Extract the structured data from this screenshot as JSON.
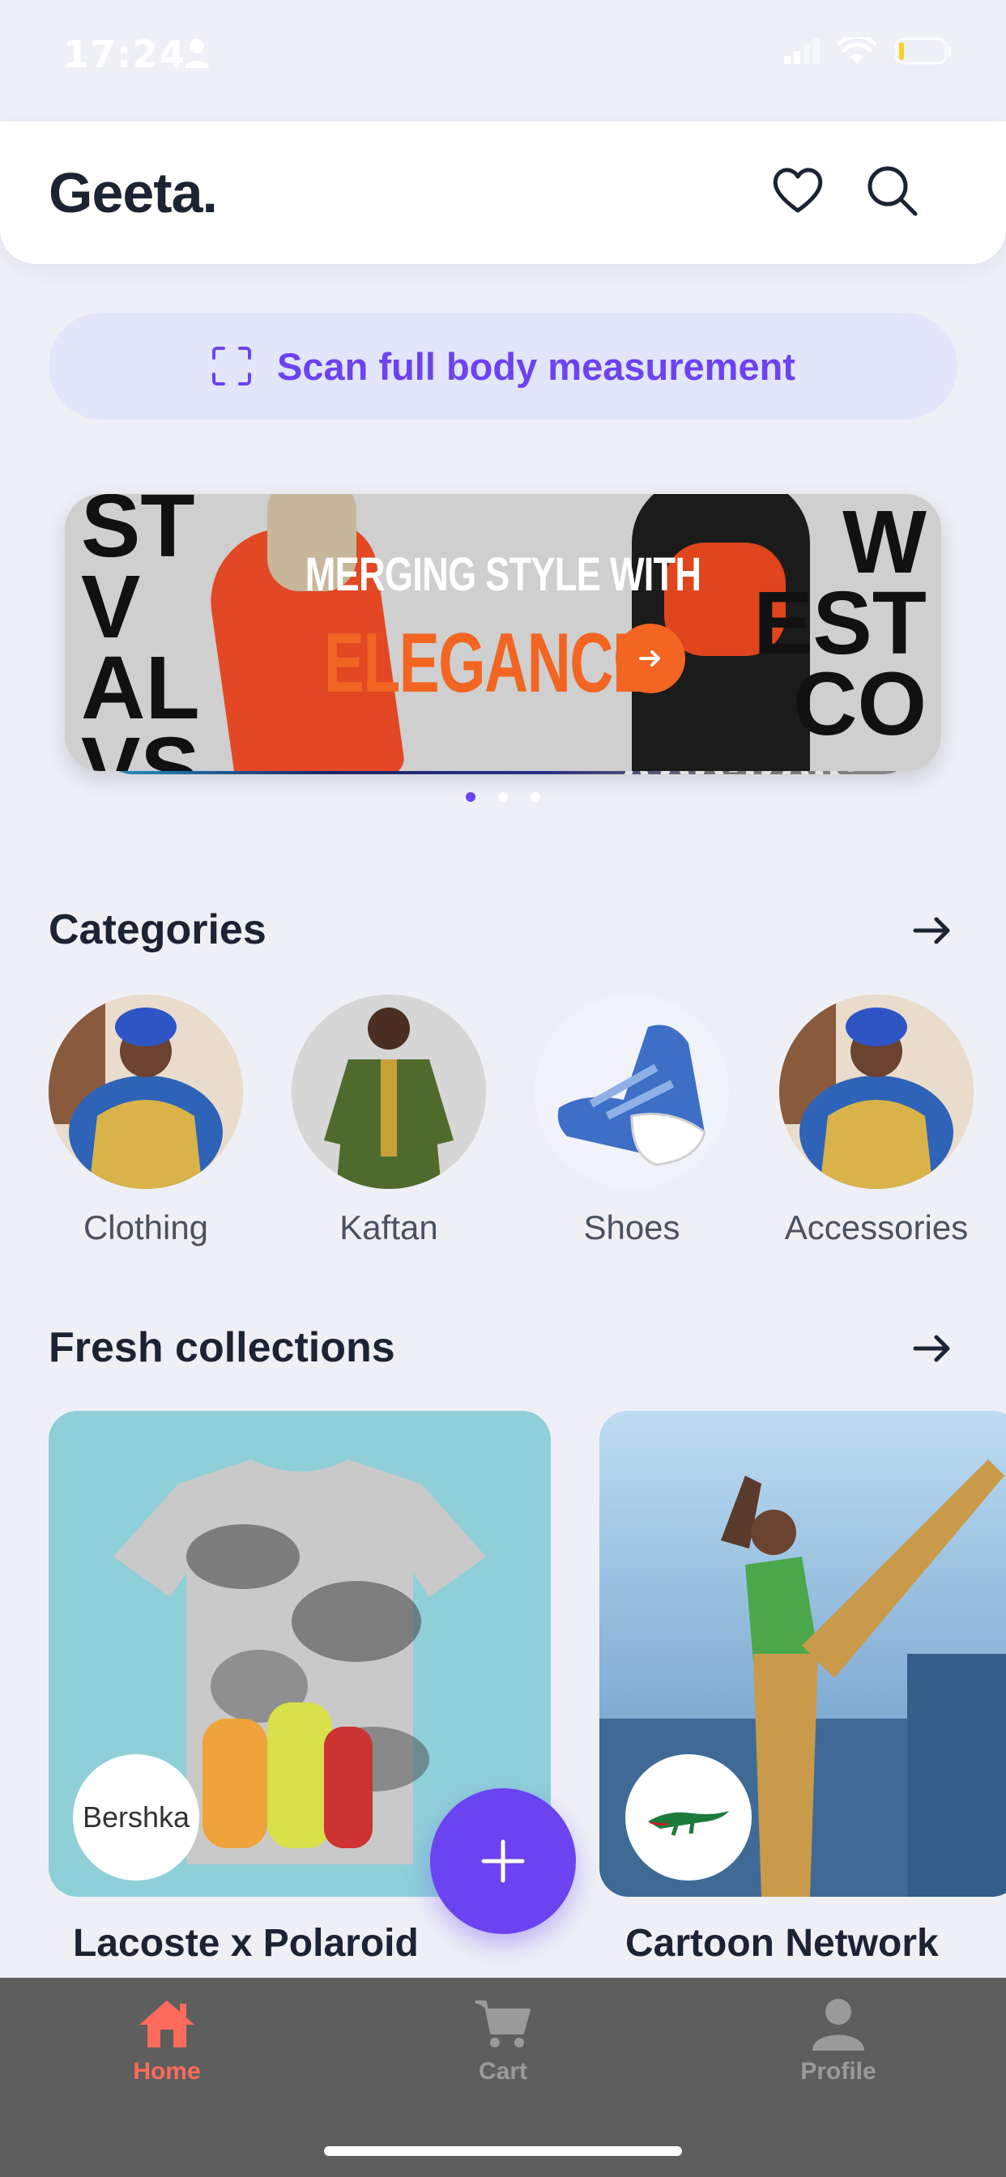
{
  "status_bar": {
    "time": "17:24"
  },
  "header": {
    "brand": "Geeta."
  },
  "scan": {
    "label": "Scan full body measurement"
  },
  "banner": {
    "top_text": "MERGING STYLE WITH",
    "big_text": "ELEGANCE",
    "left_letters": "ST\nV\nAL\nVS.",
    "right_letters": "W\nEST\nCO",
    "back_text": "Apparels",
    "dots": 3,
    "active_dot": 0
  },
  "categories": {
    "title": "Categories",
    "items": [
      {
        "label": "Clothing"
      },
      {
        "label": "Kaftan"
      },
      {
        "label": "Shoes"
      },
      {
        "label": "Accessories"
      }
    ]
  },
  "collections": {
    "title": "Fresh collections",
    "items": [
      {
        "title": "Lacoste x Polaroid",
        "logo_text": "Bershka"
      },
      {
        "title": "Cartoon Network",
        "logo_text": ""
      }
    ]
  },
  "bottom_nav": {
    "items": [
      {
        "label": "Home",
        "icon": "home-icon",
        "active": true
      },
      {
        "label": "Cart",
        "icon": "cart-icon",
        "active": false
      },
      {
        "label": "Profile",
        "icon": "profile-icon",
        "active": false
      }
    ]
  },
  "colors": {
    "accent": "#6b43f0",
    "active_nav": "#ff6b5b",
    "inactive_nav": "#9a9a9a",
    "background": "#eef0f6"
  }
}
